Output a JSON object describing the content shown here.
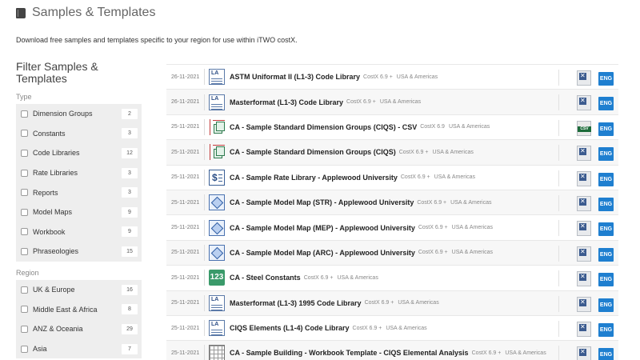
{
  "header": {
    "title": "Samples & Templates"
  },
  "intro": "Download free samples and templates specific to your region for use within iTWO costX.",
  "filter": {
    "title": "Filter Samples & Templates",
    "type_label": "Type",
    "types": [
      {
        "label": "Dimension Groups",
        "count": "2"
      },
      {
        "label": "Constants",
        "count": "3"
      },
      {
        "label": "Code Libraries",
        "count": "12"
      },
      {
        "label": "Rate Libraries",
        "count": "3"
      },
      {
        "label": "Reports",
        "count": "3"
      },
      {
        "label": "Model Maps",
        "count": "9"
      },
      {
        "label": "Workbook",
        "count": "9"
      },
      {
        "label": "Phraseologies",
        "count": "15"
      }
    ],
    "region_label": "Region",
    "regions": [
      {
        "label": "UK & Europe",
        "count": "16"
      },
      {
        "label": "Middle East & Africa",
        "count": "8"
      },
      {
        "label": "ANZ & Oceania",
        "count": "29"
      },
      {
        "label": "Asia",
        "count": "7"
      }
    ]
  },
  "items": [
    {
      "date": "26-11-2021",
      "name": "ASTM Uniformat II (L1-3) Code Library",
      "version": "CostX 6.9 +",
      "region": "USA & Americas",
      "icon": "code-library",
      "file": "costx-file",
      "lang": "ENG"
    },
    {
      "date": "26-11-2021",
      "name": "Masterformat (L1-3) Code Library",
      "version": "CostX 6.9 +",
      "region": "USA & Americas",
      "icon": "code-library",
      "file": "costx-file",
      "lang": "ENG"
    },
    {
      "date": "25-11-2021",
      "name": "CA - Sample Standard Dimension Groups (CIQS) - CSV",
      "version": "CostX 6.9",
      "region": "USA & Americas",
      "icon": "dimension-group",
      "file": "csv-file",
      "lang": "ENG"
    },
    {
      "date": "25-11-2021",
      "name": "CA - Sample Standard Dimension Groups (CIQS)",
      "version": "CostX 6.9 +",
      "region": "USA & Americas",
      "icon": "dimension-group",
      "file": "costx-file",
      "lang": "ENG"
    },
    {
      "date": "25-11-2021",
      "name": "CA - Sample Rate Library - Applewood University",
      "version": "CostX 6.9 +",
      "region": "USA & Americas",
      "icon": "rate-library",
      "file": "costx-file",
      "lang": "ENG"
    },
    {
      "date": "25-11-2021",
      "name": "CA - Sample Model Map (STR) - Applewood University",
      "version": "CostX 6.9 +",
      "region": "USA & Americas",
      "icon": "model-map",
      "file": "costx-file",
      "lang": "ENG"
    },
    {
      "date": "25-11-2021",
      "name": "CA - Sample Model Map (MEP) - Applewood University",
      "version": "CostX 6.9 +",
      "region": "USA & Americas",
      "icon": "model-map",
      "file": "costx-file",
      "lang": "ENG"
    },
    {
      "date": "25-11-2021",
      "name": "CA - Sample Model Map (ARC) - Applewood University",
      "version": "CostX 6.9 +",
      "region": "USA & Americas",
      "icon": "model-map",
      "file": "costx-file",
      "lang": "ENG"
    },
    {
      "date": "25-11-2021",
      "name": "CA - Steel Constants",
      "version": "CostX 6.9 +",
      "region": "USA & Americas",
      "icon": "constants",
      "icon_text": "123",
      "file": "costx-file",
      "lang": "ENG"
    },
    {
      "date": "25-11-2021",
      "name": "Masterformat (L1-3) 1995 Code Library",
      "version": "CostX 6.9 +",
      "region": "USA & Americas",
      "icon": "code-library",
      "file": "costx-file",
      "lang": "ENG"
    },
    {
      "date": "25-11-2021",
      "name": "CIQS Elements (L1-4) Code Library",
      "version": "CostX 6.9 +",
      "region": "USA & Americas",
      "icon": "code-library",
      "file": "costx-file",
      "lang": "ENG"
    },
    {
      "date": "25-11-2021",
      "name": "CA - Sample Building - Workbook Template - CIQS Elemental Analysis",
      "version": "CostX 6.9 +",
      "region": "USA & Americas",
      "icon": "workbook",
      "file": "costx-file",
      "lang": "ENG"
    }
  ],
  "icon_labels": {
    "code_library": "LA",
    "csv": "CSV"
  },
  "colors": {
    "lang_badge": "#1f7fd0",
    "constants_icon": "#3a9a6a"
  }
}
